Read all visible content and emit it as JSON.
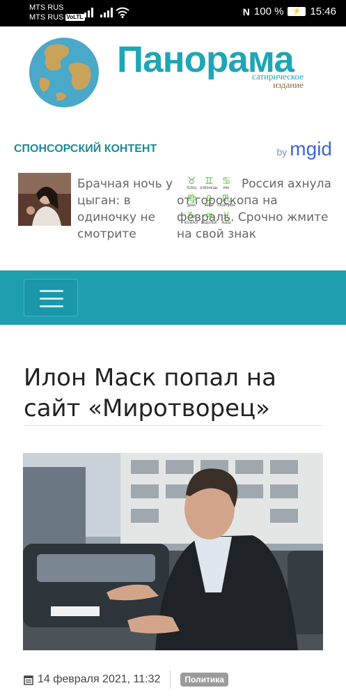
{
  "status_bar": {
    "carrier1": "MTS RUS",
    "carrier2": "MTS RUS",
    "volte": "VoLTE",
    "nfc": "N",
    "battery": "100 %",
    "time": "15:46"
  },
  "header": {
    "brand": "Панорама",
    "brand_sub_line1": "сатирическое",
    "brand_sub_line2": "издание"
  },
  "sponsored": {
    "title": "СПОНСОРСКИЙ КОНТЕНТ",
    "by": "by",
    "network": "mgid",
    "ads": [
      {
        "text": "Брачная ночь у цыган: в одиночку не смотрите"
      },
      {
        "text": "Россия ахнула от гороскопа на февраль. Срочно жмите на свой знак"
      }
    ],
    "zodiac_labels": [
      "ТЕЛЕЦ",
      "БЛИЗНЕЦЫ",
      "РАК",
      "ДЕВА",
      "ВЕСЫ",
      "СКОРПИОН",
      "КОЗЕРОГ",
      "ВОДОЛЕЙ",
      "РЫБЫ"
    ]
  },
  "nav": {
    "menu_icon": "hamburger-icon"
  },
  "article": {
    "title": "Илон Маск попал на сайт «Миротворец»",
    "date": "14 февраля 2021, 11:32",
    "category": "Политика"
  },
  "colors": {
    "accent": "#1f9eb0",
    "brand": "#1fa6b5",
    "sponsor_title": "#1f8a98",
    "mgid": "#3f64d8"
  }
}
